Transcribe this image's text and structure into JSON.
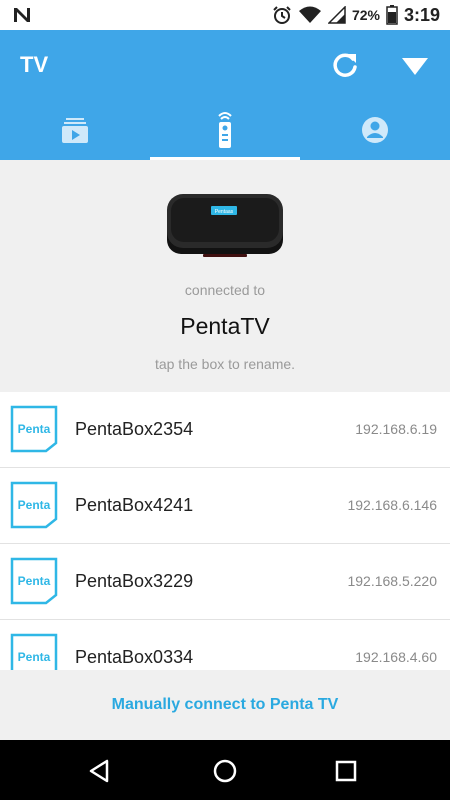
{
  "status_bar": {
    "battery_percent": "72%",
    "time": "3:19",
    "icons": [
      "n-notification-icon",
      "alarm-icon",
      "wifi-icon",
      "signal-icon",
      "battery-icon"
    ]
  },
  "app_bar": {
    "title": "TV",
    "icons": [
      "refresh-icon",
      "dropdown-icon"
    ]
  },
  "tabs": [
    {
      "icon": "video-library-icon",
      "active": false
    },
    {
      "icon": "remote-icon",
      "active": true
    },
    {
      "icon": "account-icon",
      "active": false
    }
  ],
  "connection": {
    "connected_label": "connected to",
    "device_name": "PentaTV",
    "rename_hint": "tap the box to rename.",
    "box_logo_text": "Pentaas"
  },
  "devices": [
    {
      "name": "PentaBox2354",
      "ip": "192.168.6.19",
      "logo": "Penta"
    },
    {
      "name": "PentaBox4241",
      "ip": "192.168.6.146",
      "logo": "Penta"
    },
    {
      "name": "PentaBox3229",
      "ip": "192.168.5.220",
      "logo": "Penta"
    },
    {
      "name": "PentaBox0334",
      "ip": "192.168.4.60",
      "logo": "Penta"
    }
  ],
  "manual_connect": {
    "label": "Manually connect to Penta TV"
  },
  "colors": {
    "primary": "#3fa6e8",
    "accent": "#2aa9e0",
    "background": "#f0f0f0"
  }
}
